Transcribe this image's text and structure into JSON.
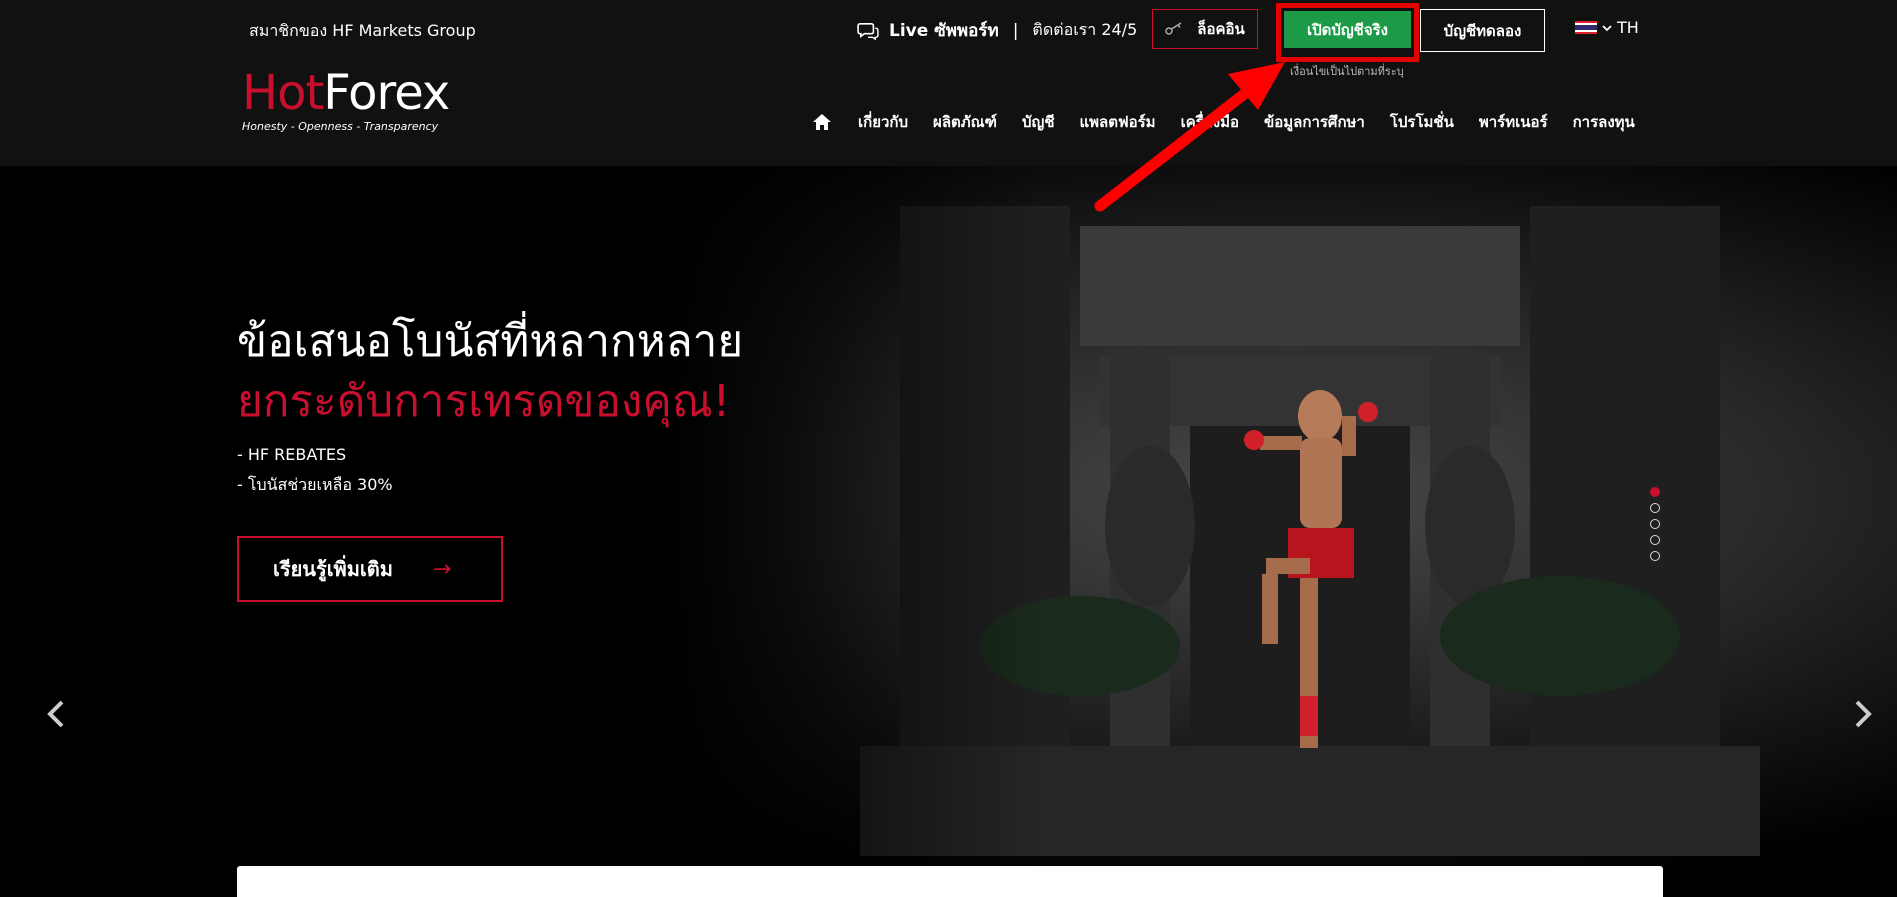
{
  "colors": {
    "brand_red": "#c8102e",
    "cta_green": "#1d9a47",
    "header_bg": "#111111",
    "highlight": "#e30000"
  },
  "topbar": {
    "member_text": "สมาชิกของ HF Markets Group",
    "support_live": "Live ซัพพอร์ท",
    "support_sep": "|",
    "support_contact": "ติดต่อเรา 24/5",
    "login_label": "ล็อคอิน",
    "real_account_label": "เปิดบัญชีจริง",
    "real_account_sub": "เงื่อนไขเป็นไปตามที่ระบุ",
    "demo_account_label": "บัญชีทดลอง",
    "language": "TH"
  },
  "logo": {
    "hot": "Hot",
    "forex": "Forex",
    "tagline": "Honesty - Openness - Transparency"
  },
  "nav": {
    "items": [
      "เกี่ยวกับ",
      "ผลิตภัณฑ์",
      "บัญชี",
      "แพลตฟอร์ม",
      "เครื่องมือ",
      "ข้อมูลการศึกษา",
      "โปรโมชั่น",
      "พาร์ทเนอร์",
      "การลงทุน"
    ]
  },
  "hero": {
    "headline_line1": "ข้อเสนอโบนัสที่หลากหลาย",
    "headline_line2": "ยกระดับการเทรดของคุณ!",
    "bullets": [
      "- HF REBATES",
      "- โบนัสช่วยเหลือ 30%"
    ],
    "cta_label": "เรียนรู้เพิ่มเติม",
    "cta_arrow": "→",
    "slides": 5,
    "active_slide": 1
  }
}
